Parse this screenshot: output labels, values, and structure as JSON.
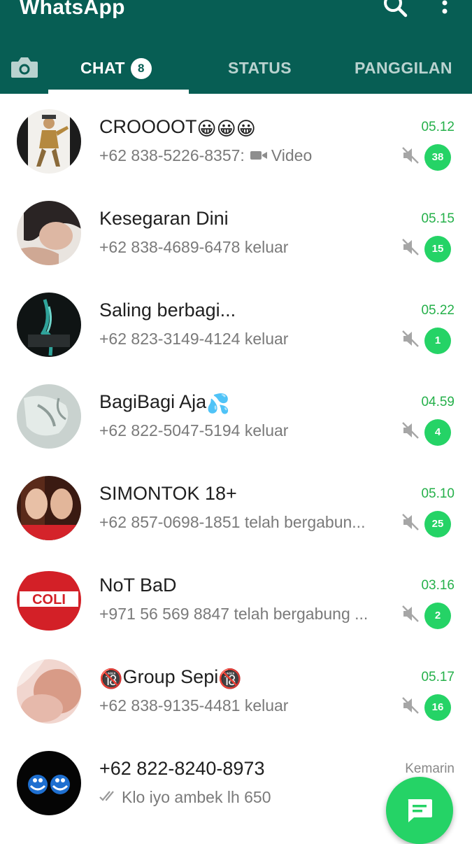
{
  "app": {
    "title": "WhatsApp"
  },
  "tabs": {
    "chat": "CHAT",
    "chat_badge": "8",
    "status": "STATUS",
    "calls": "PANGGILAN"
  },
  "chats": [
    {
      "name": "CROOOOT",
      "name_suffix": "😀😀😀",
      "preview": "+62 838-5226-8357:",
      "preview_media": "Video",
      "time": "05.12",
      "unread": "38",
      "muted": true
    },
    {
      "name": "Kesegaran Dini",
      "preview": "+62 838-4689-6478 keluar",
      "time": "05.15",
      "unread": "15",
      "muted": true
    },
    {
      "name": "Saling berbagi...",
      "preview": "+62 823-3149-4124 keluar",
      "time": "05.22",
      "unread": "1",
      "muted": true
    },
    {
      "name": "BagiBagi Aja",
      "name_suffix": "💦",
      "preview": "+62 822-5047-5194 keluar",
      "time": "04.59",
      "unread": "4",
      "muted": true
    },
    {
      "name": "SIMONTOK 18+",
      "preview": "+62 857-0698-1851 telah bergabun...",
      "time": "05.10",
      "unread": "25",
      "muted": true
    },
    {
      "name": "NoT BaD",
      "preview": "+971 56 569 8847 telah bergabung ...",
      "time": "03.16",
      "unread": "2",
      "muted": true,
      "avatar_text": "COLI"
    },
    {
      "name_prefix": "🔞",
      "name": "Group Sepi",
      "name_suffix": "🔞",
      "preview": "+62 838-9135-4481 keluar",
      "time": "05.17",
      "unread": "16",
      "muted": true
    },
    {
      "name": "+62 822-8240-8973",
      "preview": "Klo iyo ambek lh 650",
      "time": "Kemarin",
      "unread": "",
      "muted": false
    }
  ],
  "colors": {
    "header": "#075e54",
    "accent": "#25d366",
    "time_unread": "#25b04a"
  },
  "icons": {
    "header": [
      "search-icon",
      "more-vert-icon"
    ],
    "tabs": [
      "camera-icon"
    ],
    "rows": [
      "mute-icon",
      "video-icon",
      "double-check-icon"
    ],
    "fab": "new-chat-icon"
  }
}
